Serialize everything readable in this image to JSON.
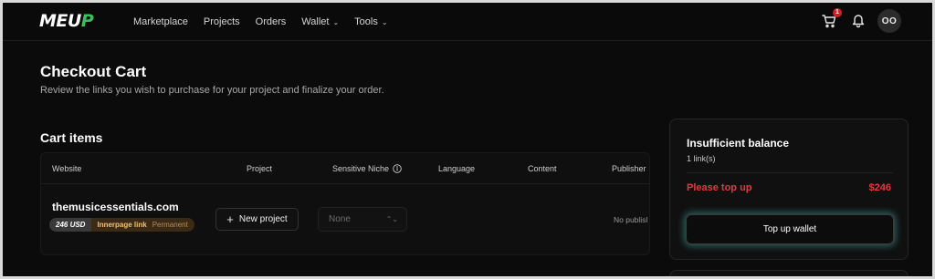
{
  "nav": {
    "logo_main": "MEU",
    "logo_accent": "P",
    "links": [
      {
        "label": "Marketplace",
        "dropdown": false
      },
      {
        "label": "Projects",
        "dropdown": false
      },
      {
        "label": "Orders",
        "dropdown": false
      },
      {
        "label": "Wallet",
        "dropdown": true
      },
      {
        "label": "Tools",
        "dropdown": true
      }
    ],
    "cart_count": "1",
    "avatar_initials": "OO"
  },
  "page": {
    "title": "Checkout Cart",
    "subtitle": "Review the links you wish to purchase for your project and finalize your order."
  },
  "cart": {
    "section_title": "Cart items",
    "columns": {
      "website": "Website",
      "project": "Project",
      "niche": "Sensitive Niche",
      "language": "Language",
      "content": "Content",
      "publisher": "Publisher"
    },
    "rows": [
      {
        "website": "themusicessentials.com",
        "price": "246 USD",
        "link_type": "Innerpage link",
        "duration": "Permanent",
        "project_button": "New project",
        "niche_value": "None",
        "publisher_value": "No publisl"
      }
    ]
  },
  "balance": {
    "title": "Insufficient balance",
    "links": "1 link(s)",
    "warning": "Please top up",
    "amount": "$246",
    "button": "Top up wallet"
  },
  "colors": {
    "background": "#0b0b0b",
    "danger": "#e23a3a",
    "accent": "#37c35a",
    "tag_gold": "#f3c26e",
    "glow": "#50c8be"
  }
}
